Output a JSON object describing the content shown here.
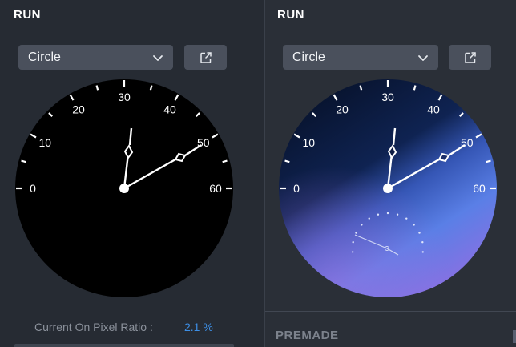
{
  "left_panel": {
    "title": "RUN",
    "shape_select": {
      "value": "Circle"
    },
    "open_external_icon": "external-link-icon",
    "pixel_ratio": {
      "label": "Current On Pixel Ratio :",
      "value": "2.1 %"
    },
    "face_colors": {
      "background": "#000000",
      "ticks": "#ffffff"
    }
  },
  "right_panel": {
    "title": "RUN",
    "shape_select": {
      "value": "Circle"
    },
    "open_external_icon": "external-link-icon",
    "section_title": "PREMADE",
    "face_colors": {
      "gradient_top": "#0b1533",
      "gradient_mid": "#4b6ed8",
      "gradient_bottom": "#8a6fe0"
    }
  },
  "dial": {
    "labels": [
      "0",
      "10",
      "20",
      "30",
      "40",
      "50",
      "60"
    ]
  },
  "colors": {
    "accent": "#3d8fe6",
    "panel_bg": "#262b33",
    "control_bg": "#4a505c"
  }
}
